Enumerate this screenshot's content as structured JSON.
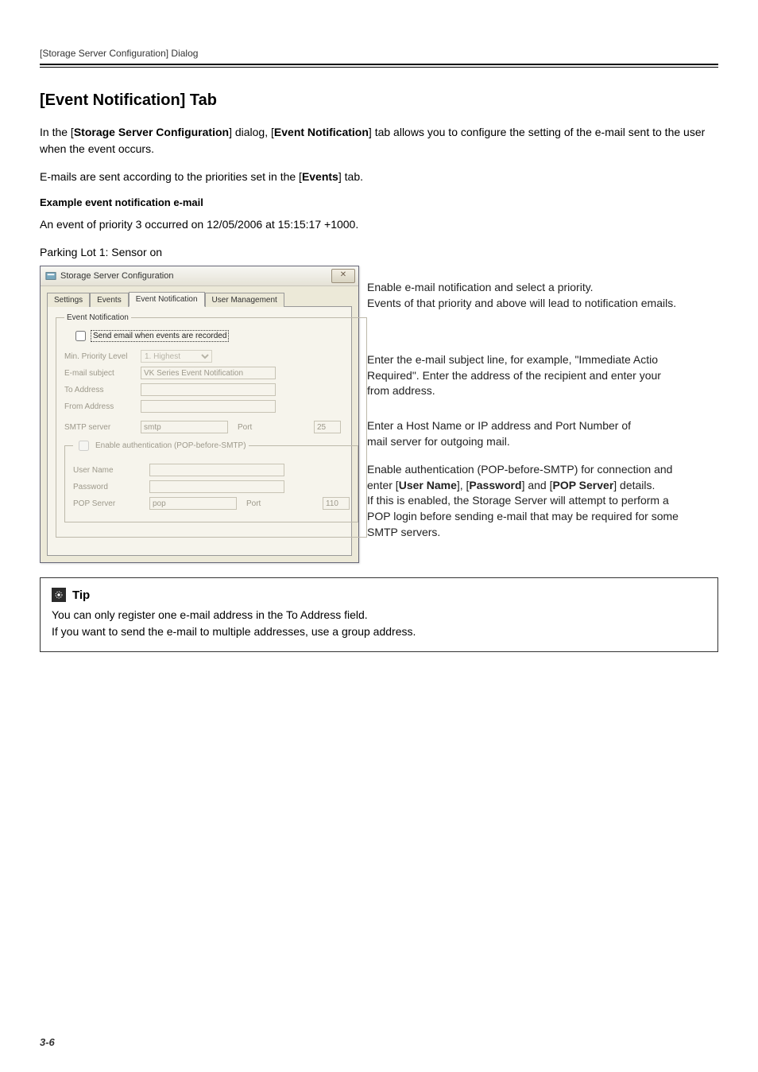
{
  "header": {
    "running_title": "[Storage Server Configuration] Dialog"
  },
  "section": {
    "title": "[Event Notification] Tab",
    "intro_pre": "In the [",
    "intro_bold1": "Storage Server Configuration",
    "intro_mid1": "] dialog, [",
    "intro_bold2": "Event Notification",
    "intro_post1": "] tab allows you to configure the setting of the e-mail sent to the user when the event occurs.",
    "intro2_pre": "E-mails are sent according to the priorities set in the [",
    "intro2_bold": "Events",
    "intro2_post": "] tab.",
    "example_heading": "Example event notification e-mail",
    "example_line1": "An event of priority 3 occurred on 12/05/2006 at 15:15:17 +1000.",
    "example_line2": "Parking Lot 1: Sensor on"
  },
  "dialog": {
    "title": "Storage Server Configuration",
    "close_glyph": "✕",
    "tabs": {
      "settings": "Settings",
      "events": "Events",
      "event_notification": "Event Notification",
      "user_management": "User Management"
    },
    "groups": {
      "event_notification_legend": "Event Notification",
      "pop_legend": "Enable authentication (POP-before-SMTP)"
    },
    "fields": {
      "send_email_label": "Send email when events are recorded",
      "min_priority_label": "Min. Priority Level",
      "min_priority_value": "1. Highest",
      "email_subject_label": "E-mail subject",
      "email_subject_value": "VK Series Event Notification",
      "to_address_label": "To Address",
      "to_address_value": "",
      "from_address_label": "From Address",
      "from_address_value": "",
      "smtp_server_label": "SMTP server",
      "smtp_server_value": "smtp",
      "smtp_port_label": "Port",
      "smtp_port_value": "25",
      "user_name_label": "User Name",
      "user_name_value": "",
      "password_label": "Password",
      "password_value": "",
      "pop_server_label": "POP Server",
      "pop_server_value": "pop",
      "pop_port_label": "Port",
      "pop_port_value": "110"
    }
  },
  "callouts": {
    "c1_l1": "Enable e-mail notification and select a priority.",
    "c1_l2": "Events of that priority and above will lead to notification emails.",
    "c2_l1": "Enter the e-mail subject line, for example, \"Immediate Actio",
    "c2_l2": "Required\". Enter the address of the recipient and enter your",
    "c2_l3": "from address.",
    "c3_l1": "Enter a Host Name or IP address and Port Number of",
    "c3_l2": "mail server for outgoing mail.",
    "c4_l1": "Enable authentication (POP-before-SMTP) for connection and",
    "c4_l2a": "enter [",
    "c4_l2b1": "User Name",
    "c4_l2c": "], [",
    "c4_l2b2": "Password",
    "c4_l2d": "] and [",
    "c4_l2b3": "POP Server",
    "c4_l2e": "] details.",
    "c4_l3": "If this is enabled, the Storage Server will attempt to perform a",
    "c4_l4": "POP login before sending e-mail that may be required for some",
    "c4_l5": "SMTP servers."
  },
  "tip": {
    "title": "Tip",
    "line1": "You can only register one e-mail address in the To Address field.",
    "line2": "If you want to send the e-mail to multiple addresses, use a group address."
  },
  "footer": {
    "page_number": "3-6"
  }
}
